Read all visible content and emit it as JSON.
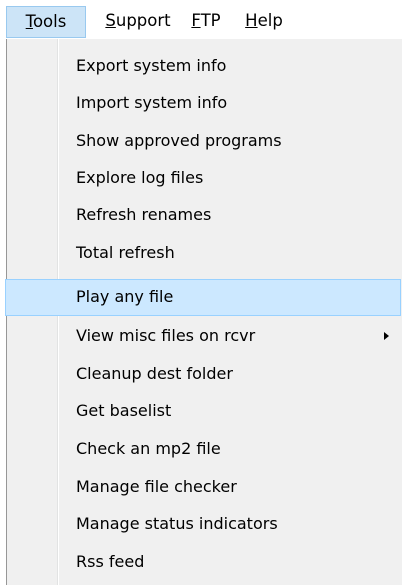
{
  "menubar": {
    "items": [
      {
        "accel": "T",
        "rest": "ools",
        "active": true
      },
      {
        "accel": "S",
        "rest": "upport",
        "active": false
      },
      {
        "accel": "F",
        "rest": "TP",
        "active": false
      },
      {
        "accel": "H",
        "rest": "elp",
        "active": false
      }
    ]
  },
  "tools_menu": {
    "items": [
      {
        "label": "Export system info"
      },
      {
        "label": "Import system info"
      },
      {
        "label": "Show approved programs"
      },
      {
        "label": "Explore log files"
      },
      {
        "label": "Refresh renames"
      },
      {
        "label": "Total refresh"
      },
      {
        "label": "Play any file",
        "highlighted": true
      },
      {
        "label": "View misc files on rcvr",
        "has_submenu": true,
        "submenu_icon": "chevron-right-icon"
      },
      {
        "label": "Cleanup dest folder"
      },
      {
        "label": "Get baselist"
      },
      {
        "label": "Check an mp2 file"
      },
      {
        "label": "Manage file checker"
      },
      {
        "label": "Manage status indicators"
      },
      {
        "label": "Rss feed"
      }
    ]
  },
  "colors": {
    "menubar_active_bg": "#cce4f7",
    "highlight_bg": "#cce8ff",
    "highlight_border": "#99d1ff",
    "menu_bg": "#f0f0f0"
  }
}
